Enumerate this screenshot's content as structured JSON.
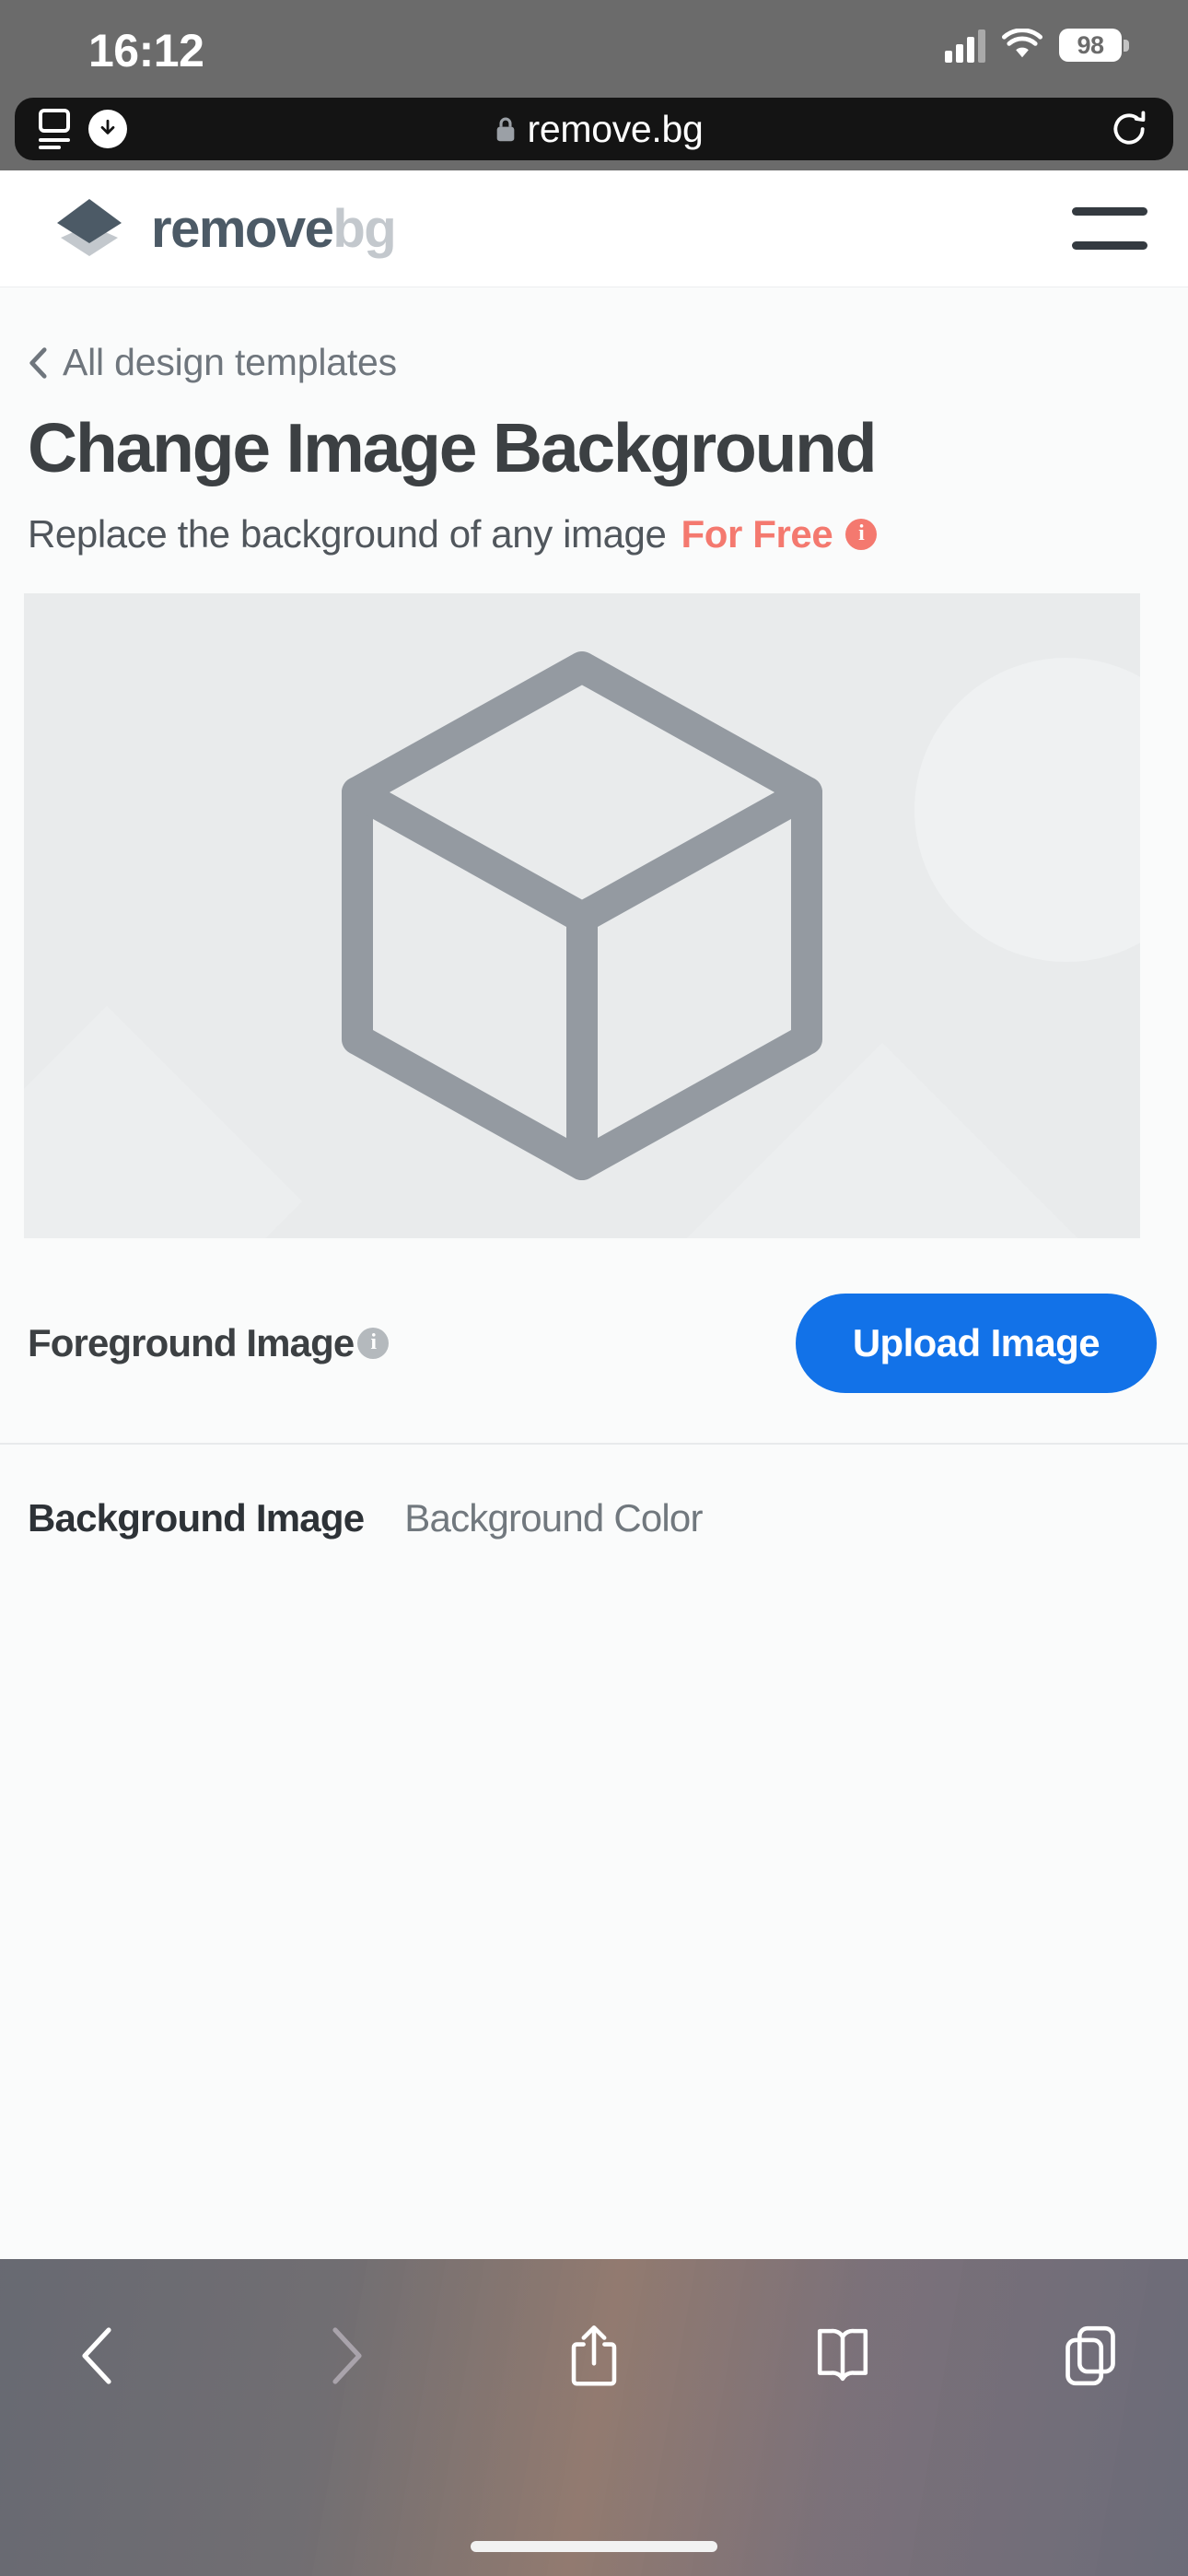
{
  "status_bar": {
    "time": "16:12",
    "battery_level": "98",
    "signal_icon": "cellular-bars-icon",
    "wifi_icon": "wifi-icon",
    "battery_icon": "battery-icon"
  },
  "browser": {
    "reader_icon": "reader-view-icon",
    "download_icon": "download-icon",
    "lock_icon": "lock-icon",
    "url": "remove.bg",
    "reload_icon": "reload-icon",
    "toolbar": {
      "back_icon": "chevron-left-icon",
      "forward_icon": "chevron-right-icon",
      "share_icon": "share-icon",
      "bookmarks_icon": "book-icon",
      "tabs_icon": "tabs-icon"
    }
  },
  "site_header": {
    "brand_primary": "remove",
    "brand_secondary": "bg",
    "logo_icon": "layers-diamond-logo",
    "menu_icon": "hamburger-menu-icon"
  },
  "hero": {
    "breadcrumb_label": "All design templates",
    "breadcrumb_icon": "chevron-left-icon",
    "title": "Change Image Background",
    "subtitle": "Replace the background of any image",
    "free_badge": "For Free",
    "free_info_icon": "info-icon"
  },
  "preview": {
    "placeholder_icon": "cube-placeholder-icon"
  },
  "foreground": {
    "label": "Foreground Image",
    "info_icon": "info-icon",
    "upload_label": "Upload Image"
  },
  "background_tabs": [
    {
      "label": "Background Image",
      "active": true
    },
    {
      "label": "Background Color",
      "active": false
    }
  ],
  "colors": {
    "accent_blue": "#1272e8",
    "brand_dark": "#4c5a66",
    "brand_light": "#c3c8cd",
    "free_coral": "#f4796f",
    "page_bg": "#fafbfb",
    "preview_bg": "#e9ebec",
    "cube_stroke": "#949aa1"
  }
}
